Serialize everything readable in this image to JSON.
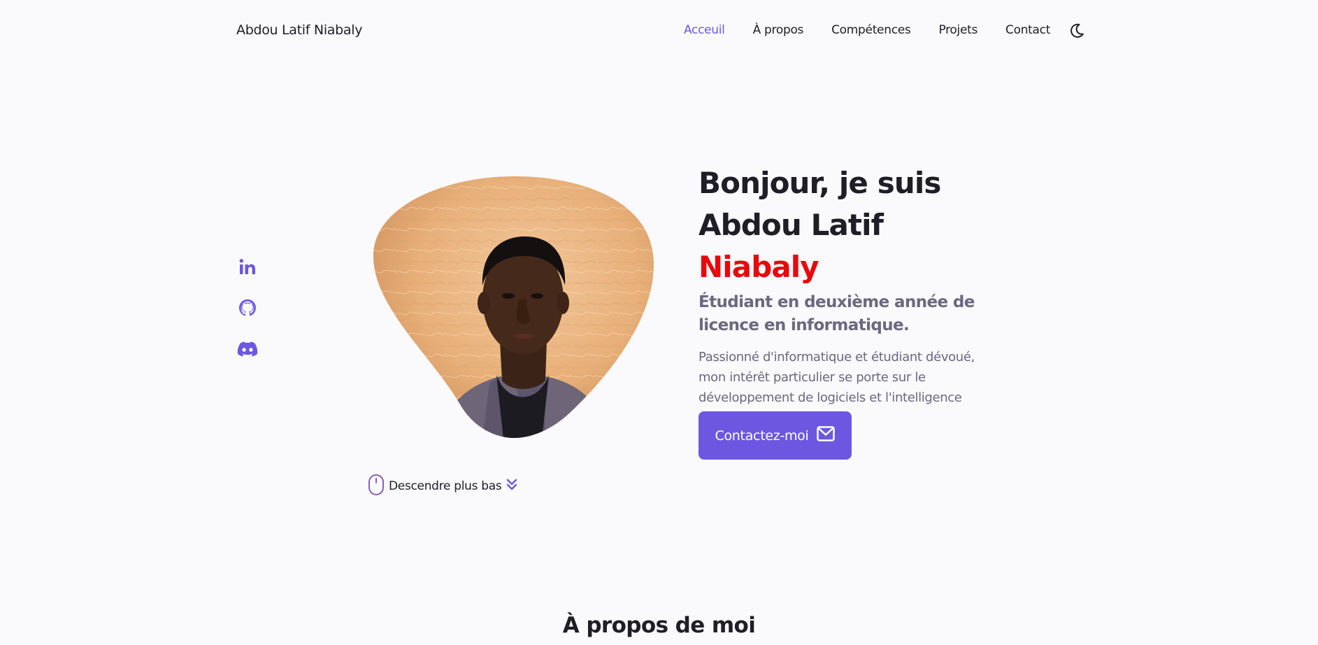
{
  "header": {
    "logo": "Abdou Latif Niabaly",
    "nav": [
      {
        "label": "Acceuil",
        "active": true
      },
      {
        "label": "À propos",
        "active": false
      },
      {
        "label": "Compétences",
        "active": false
      },
      {
        "label": "Projets",
        "active": false
      },
      {
        "label": "Contact",
        "active": false
      }
    ],
    "theme_icon": "moon-icon"
  },
  "socials": [
    {
      "icon": "linkedin-icon"
    },
    {
      "icon": "github-icon"
    },
    {
      "icon": "discord-icon"
    }
  ],
  "hero": {
    "title_line1": "Bonjour, je suis",
    "title_line2_prefix": "Abdou Latif ",
    "title_line2_accent": "Niabaly",
    "subtitle": "Étudiant en deuxième année de licence en informatique.",
    "description": "Passionné d'informatique et étudiant dévoué, mon intérêt particulier se porte sur le développement de logiciels et l'intelligence artificielle.",
    "contact_button": "Contactez-moi",
    "contact_icon": "envelope-icon",
    "scroll_label": "Descendre plus bas",
    "scroll_icon": "mouse-icon",
    "scroll_arrow_icon": "double-chevron-down-icon"
  },
  "about": {
    "title": "À propos de moi"
  },
  "colors": {
    "accent": "#6e57e0",
    "name_highlight": "#e8080c",
    "background": "#faf9fc",
    "text": "#1f1d26",
    "muted": "#6b6880"
  }
}
